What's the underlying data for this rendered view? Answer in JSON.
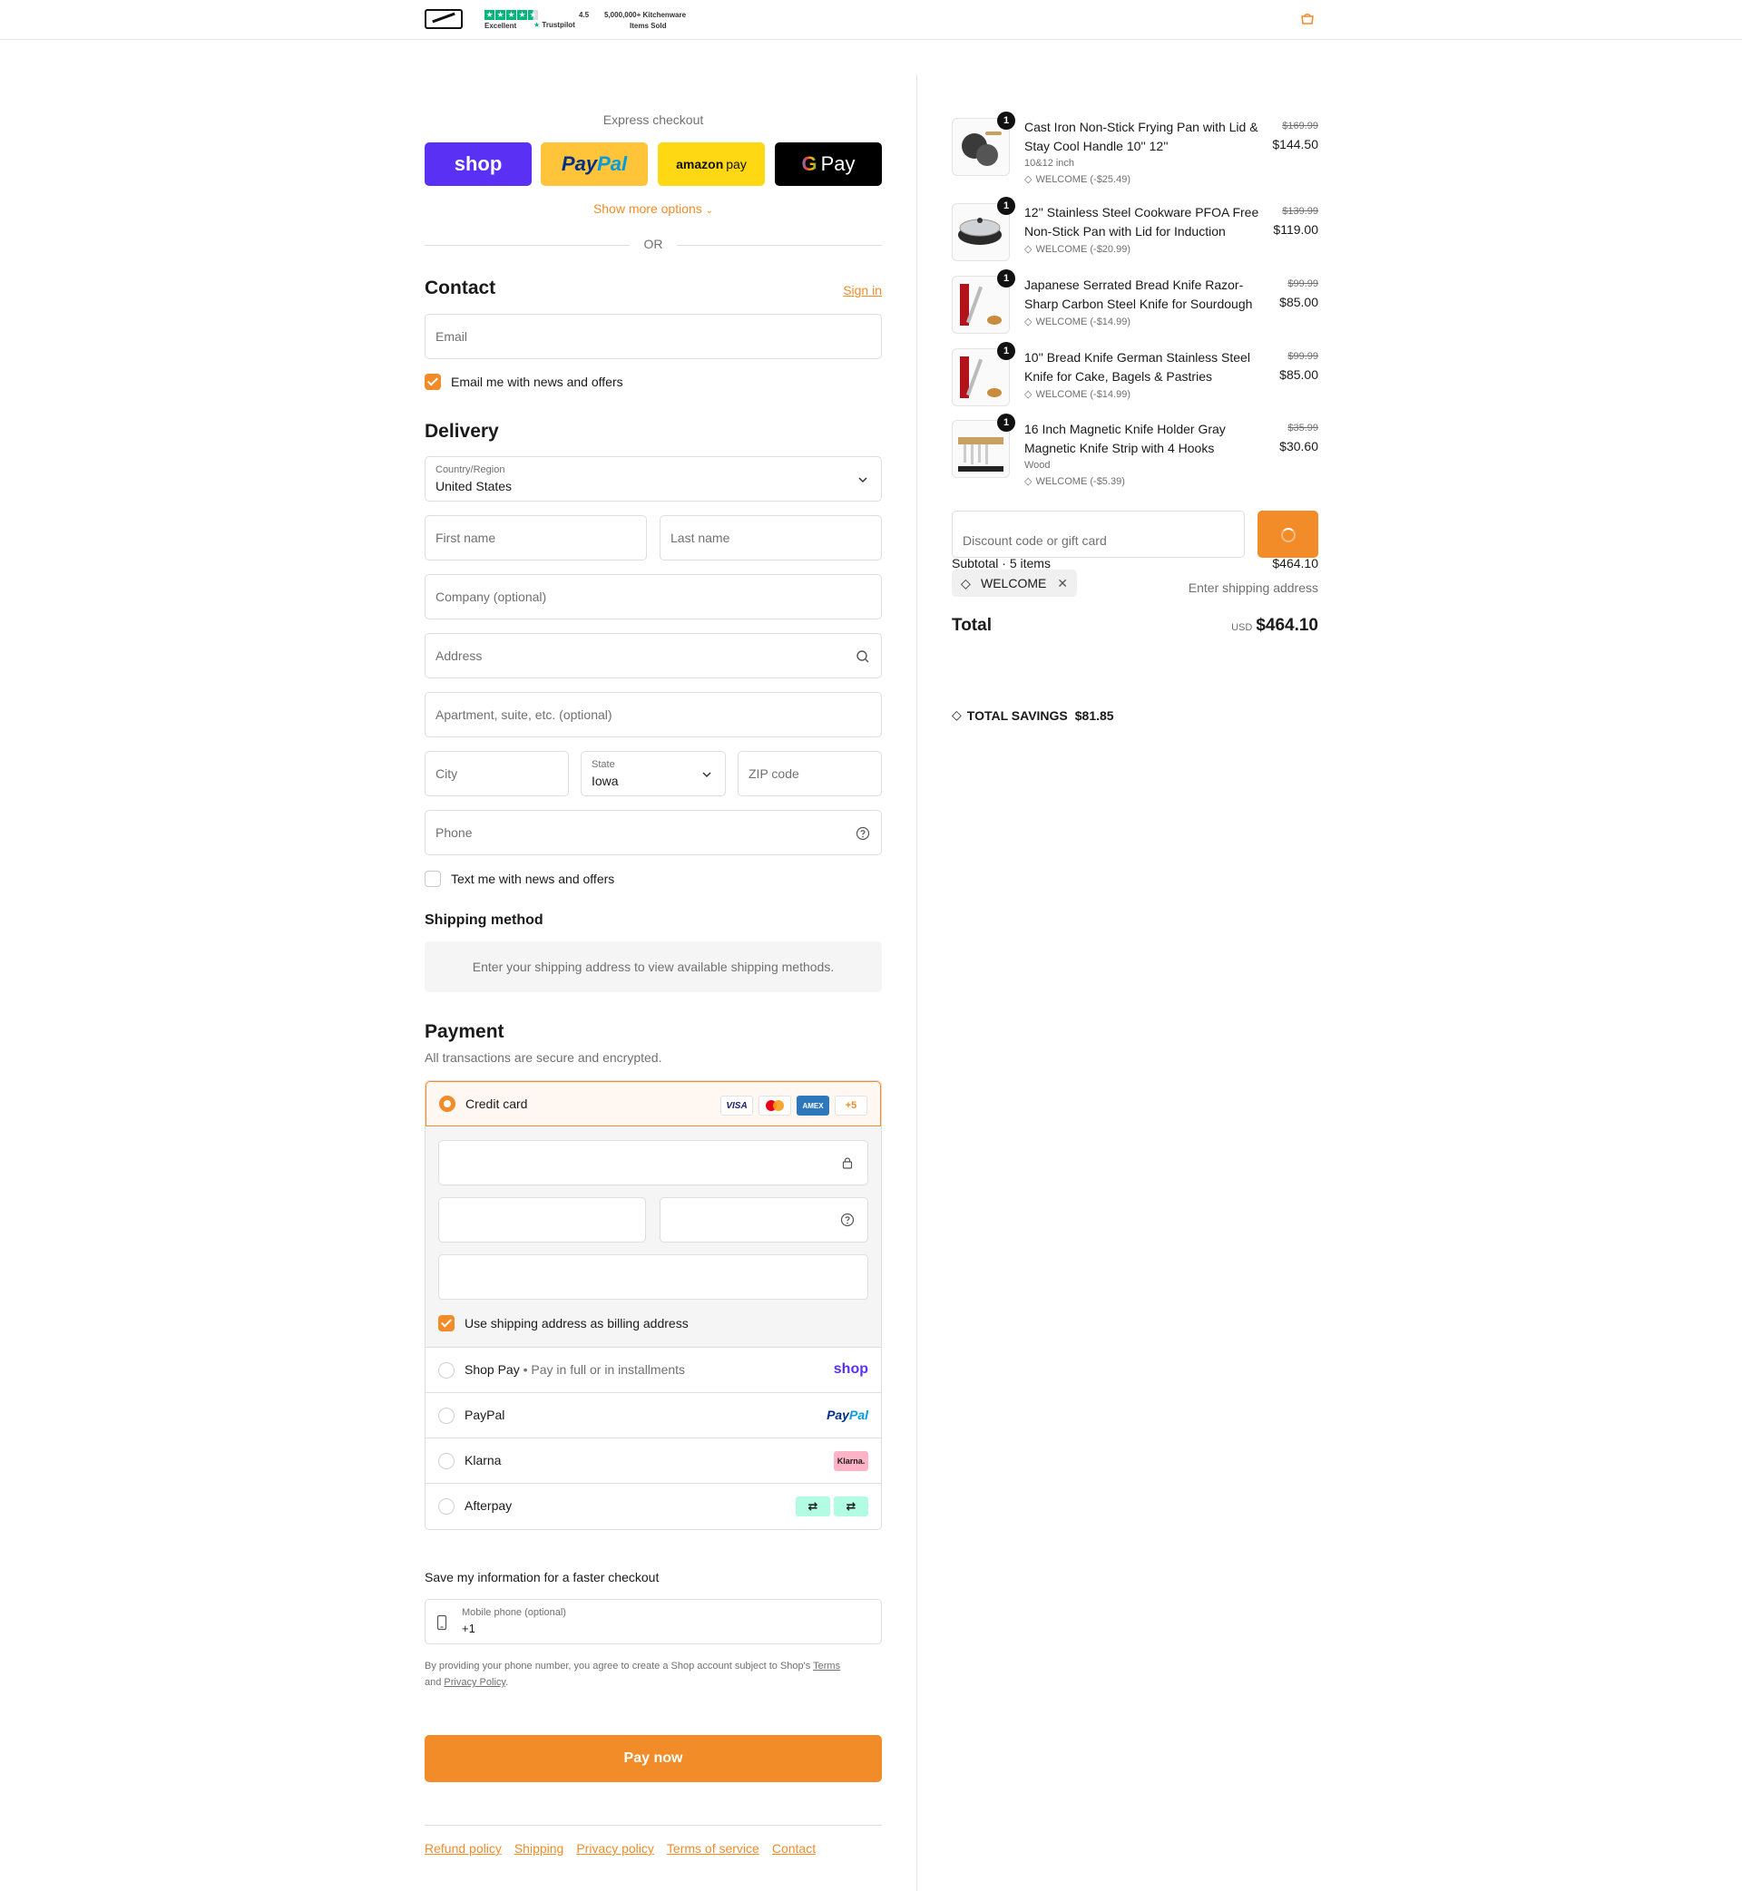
{
  "header": {
    "trustpilot_rating": "4.5",
    "trustpilot_excellent": "Excellent",
    "trustpilot_brand": "Trustpilot",
    "sold_line1": "5,000,000+ Kitchenware",
    "sold_line2": "Items Sold"
  },
  "express": {
    "title": "Express checkout",
    "shop_label": "shop",
    "paypal_label_a": "Pay",
    "paypal_label_b": "Pal",
    "amazon_label_a": "amazon",
    "amazon_label_b": "pay",
    "gpay_label_a": "G",
    "gpay_label_b": "Pay",
    "show_more": "Show more options",
    "or": "OR"
  },
  "contact": {
    "title": "Contact",
    "sign_in": "Sign in",
    "email_placeholder": "Email",
    "news_label": "Email me with news and offers"
  },
  "delivery": {
    "title": "Delivery",
    "country_label": "Country/Region",
    "country_value": "United States",
    "first_name": "First name",
    "last_name": "Last name",
    "company": "Company (optional)",
    "address": "Address",
    "apartment": "Apartment, suite, etc. (optional)",
    "city": "City",
    "state_label": "State",
    "state_value": "Iowa",
    "zip": "ZIP code",
    "phone": "Phone",
    "text_label": "Text me with news and offers"
  },
  "shipping": {
    "title": "Shipping method",
    "message": "Enter your shipping address to view available shipping methods."
  },
  "payment": {
    "title": "Payment",
    "subtitle": "All transactions are secure and encrypted.",
    "credit_card": "Credit card",
    "card_visa": "VISA",
    "card_amex": "AMEX",
    "card_more": "+5",
    "billing_label": "Use shipping address as billing address",
    "shop_pay": "Shop Pay",
    "shop_pay_sub": "Pay in full or in installments",
    "shop_logo": "shop",
    "paypal": "PayPal",
    "paypal_logo_a": "Pay",
    "paypal_logo_b": "Pal",
    "klarna": "Klarna",
    "klarna_logo": "Klarna.",
    "afterpay": "Afterpay"
  },
  "save_info": {
    "title": "Save my information for a faster checkout",
    "mobile_label": "Mobile phone (optional)",
    "mobile_value": "+1",
    "disclaimer_a": "By providing your phone number, you agree to create a Shop account subject to Shop's ",
    "terms": "Terms",
    "disclaimer_b": "and ",
    "privacy": "Privacy Policy",
    "disclaimer_end": "."
  },
  "pay_now": "Pay now",
  "footer": {
    "links": [
      "Refund policy",
      "Shipping",
      "Privacy policy",
      "Terms of service",
      "Contact"
    ]
  },
  "cart": {
    "items": [
      {
        "qty": "1",
        "title": "Cast Iron Non-Stick Frying Pan with Lid & Stay Cool Handle 10'' 12''",
        "variant": "10&12 inch",
        "discount": "WELCOME (-$25.49)",
        "old_price": "$169.99",
        "price": "$144.50"
      },
      {
        "qty": "1",
        "title": "12'' Stainless Steel Cookware PFOA Free Non-Stick Pan with Lid for Induction",
        "variant": "",
        "discount": "WELCOME (-$20.99)",
        "old_price": "$139.99",
        "price": "$119.00"
      },
      {
        "qty": "1",
        "title": "Japanese Serrated Bread Knife Razor-Sharp Carbon Steel Knife for Sourdough",
        "variant": "",
        "discount": "WELCOME (-$14.99)",
        "old_price": "$99.99",
        "price": "$85.00"
      },
      {
        "qty": "1",
        "title": "10'' Bread Knife German Stainless Steel Knife for Cake, Bagels & Pastries",
        "variant": "",
        "discount": "WELCOME (-$14.99)",
        "old_price": "$99.99",
        "price": "$85.00"
      },
      {
        "qty": "1",
        "title": "16 Inch Magnetic Knife Holder Gray Magnetic Knife Strip with 4 Hooks",
        "variant": "Wood",
        "discount": "WELCOME (-$5.39)",
        "old_price": "$35.99",
        "price": "$30.60"
      }
    ],
    "discount_placeholder": "Discount code or gift card",
    "subtotal_label": "Subtotal · 5 items",
    "subtotal_value": "$464.10",
    "applied_code": "WELCOME",
    "shipping_label": "Enter shipping address",
    "total_label": "Total",
    "currency": "USD",
    "total_value": "$464.10",
    "savings_label": "TOTAL SAVINGS",
    "savings_value": "$81.85"
  },
  "colors": {
    "accent": "#f28c28",
    "shop": "#5a31f4",
    "paypal_yellow": "#ffc439",
    "amazon_yellow": "#ffd814",
    "trustpilot_green": "#00b67a"
  }
}
